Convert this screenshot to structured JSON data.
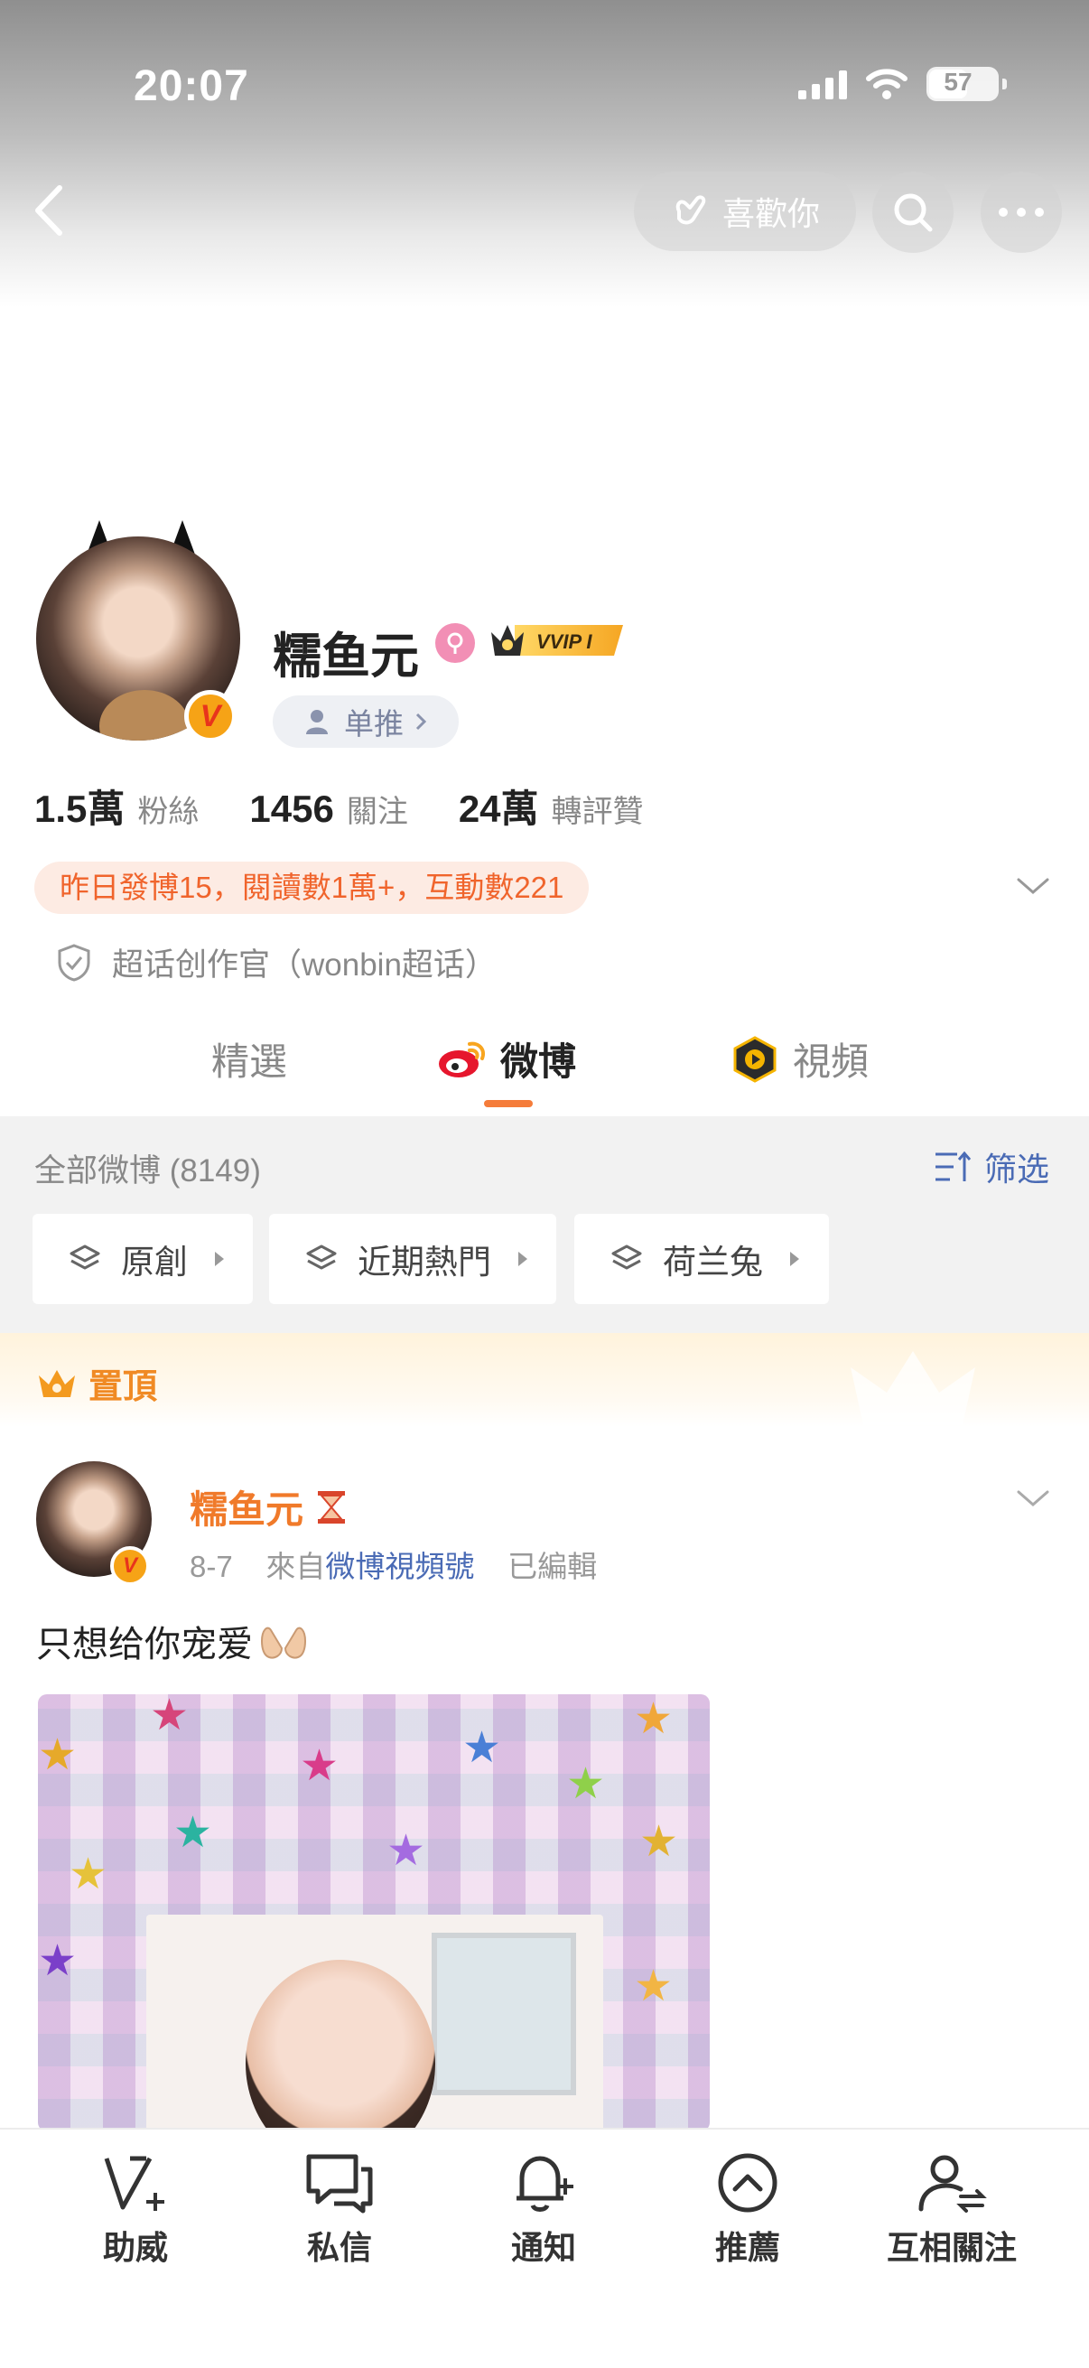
{
  "status_bar": {
    "time": "20:07",
    "battery": "57"
  },
  "header": {
    "like_label": "喜歡你"
  },
  "profile": {
    "name": "糯鱼元",
    "vip_badge": "VVIP I",
    "verified_badge": "V",
    "danpin_label": "单推",
    "stats": [
      {
        "value": "1.5萬",
        "label": "粉絲"
      },
      {
        "value": "1456",
        "label": "關注"
      },
      {
        "value": "24萬",
        "label": "轉評贊"
      }
    ],
    "activity": "昨日發博15，閱讀數1萬+，互動數221",
    "supertopic": "超话创作官（wonbin超话）"
  },
  "tabs": [
    {
      "label": "精選"
    },
    {
      "label": "微博"
    },
    {
      "label": "視頻"
    }
  ],
  "filter": {
    "all_count": "全部微博 (8149)",
    "filter_label": "筛选",
    "chips": [
      "原創",
      "近期熱門",
      "荷兰兔"
    ]
  },
  "pinned": {
    "label": "置頂"
  },
  "post": {
    "author": "糯鱼元",
    "date": "8-7",
    "from_prefix": "來自",
    "source": "微博視頻號",
    "edited": "已編輯",
    "text": "只想给你宠爱"
  },
  "bottom_bar": [
    {
      "label": "助威",
      "icon": "cheer-icon"
    },
    {
      "label": "私信",
      "icon": "message-icon"
    },
    {
      "label": "通知",
      "icon": "bell-icon"
    },
    {
      "label": "推薦",
      "icon": "recommend-icon"
    },
    {
      "label": "互相關注",
      "icon": "mutual-follow-icon"
    }
  ],
  "colors": {
    "accent": "#f57c3a",
    "link": "#4a6bb5",
    "activity_text": "#f0642c",
    "pinned": "#f08a24"
  }
}
